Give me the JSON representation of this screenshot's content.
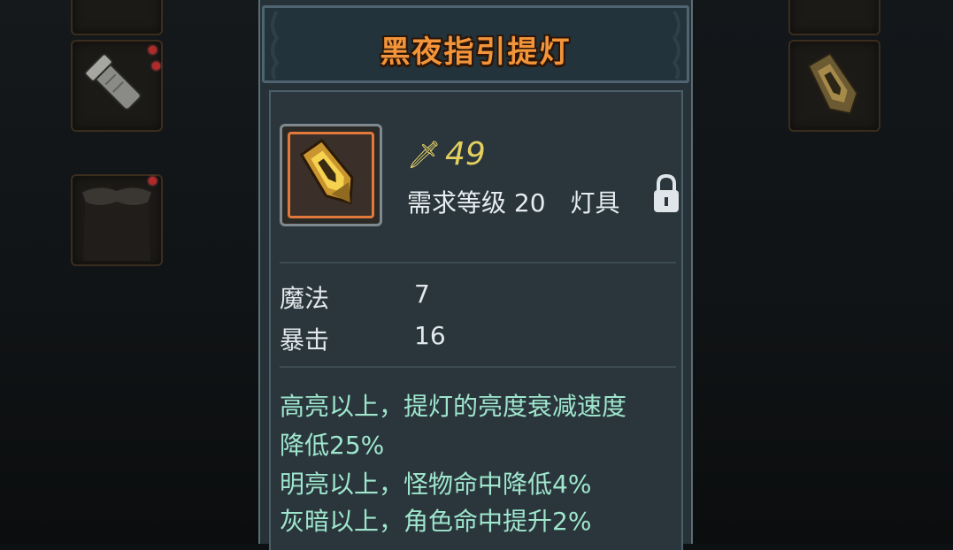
{
  "item": {
    "title": "黑夜指引提灯",
    "power": "49",
    "requirement": "需求等级 20　灯具"
  },
  "stats": [
    {
      "label": "魔法",
      "value": "7"
    },
    {
      "label": "暴击",
      "value": "16"
    }
  ],
  "effects": [
    "高亮以上，提灯的亮度衰减速度",
    "降低25%",
    "明亮以上，怪物命中降低4%",
    "灰暗以上，角色命中提升2%"
  ],
  "icons": {
    "power": "sword-power-icon",
    "lock": "lock-icon",
    "item": "golden-lamp-icon"
  },
  "colors": {
    "title": "#f2943a",
    "power": "#e4cf5f",
    "effect": "#9fe6cd",
    "slot_border": "#e0793a"
  }
}
